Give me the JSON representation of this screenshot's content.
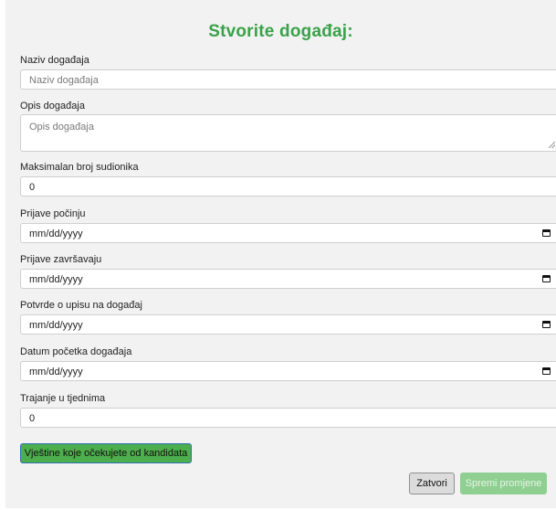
{
  "form": {
    "title": "Stvorite događaj:",
    "event_name": {
      "label": "Naziv događaja",
      "placeholder": "Naziv događaja"
    },
    "event_description": {
      "label": "Opis događaja",
      "placeholder": "Opis događaja"
    },
    "max_participants": {
      "label": "Maksimalan broj sudionika",
      "value": "0"
    },
    "applications_start": {
      "label": "Prijave počinju",
      "value": "mm/dd/yyyy",
      "icon": "calendar-icon"
    },
    "applications_end": {
      "label": "Prijave završavaju",
      "value": "mm/dd/yyyy",
      "icon": "calendar-icon"
    },
    "enrollment_confirmation": {
      "label": "Potvrde o upisu na događaj",
      "value": "mm/dd/yyyy",
      "icon": "calendar-icon"
    },
    "event_start_date": {
      "label": "Datum početka događaja",
      "value": "mm/dd/yyyy",
      "icon": "calendar-icon"
    },
    "duration_weeks": {
      "label": "Trajanje u tjednima",
      "value": "0"
    },
    "skills_button_label": "Vještine koje očekujete od kandidata"
  },
  "footer": {
    "close_label": "Zatvori",
    "save_label": "Spremi promjene"
  },
  "colors": {
    "title": "#3aa24a",
    "skills_button": "#4cae4c",
    "save_button_disabled": "#8fcf91",
    "modal_background": "#f2f2f2"
  }
}
